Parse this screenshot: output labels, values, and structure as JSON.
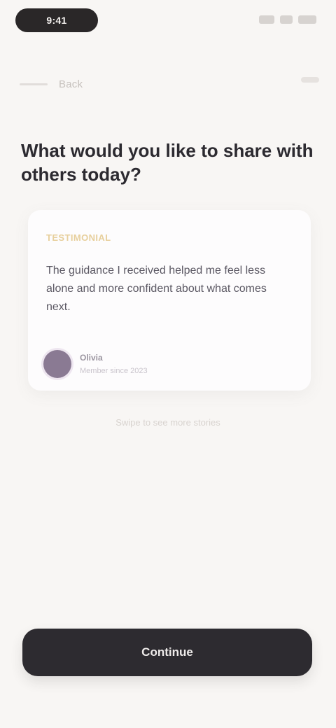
{
  "status_bar": {
    "time": "9:41",
    "icons": [
      "signal-icon",
      "wifi-icon",
      "battery-icon"
    ]
  },
  "nav": {
    "back_label": "Back",
    "icons": [
      "back-arrow-icon",
      "more-icon"
    ]
  },
  "headline": "What would you like to share with others today?",
  "card": {
    "tag": "TESTIMONIAL",
    "body": "The guidance I received helped me feel less alone and more confident about what comes next.",
    "author_name": "Olivia",
    "author_role": "Member since 2023"
  },
  "caption": "Swipe to see more stories",
  "cta": {
    "label": "Continue"
  },
  "colors": {
    "background": "#f8f6f4",
    "primary": "#2d2b30",
    "accent": "#e7cf9c",
    "avatar": "#8a7a93"
  }
}
